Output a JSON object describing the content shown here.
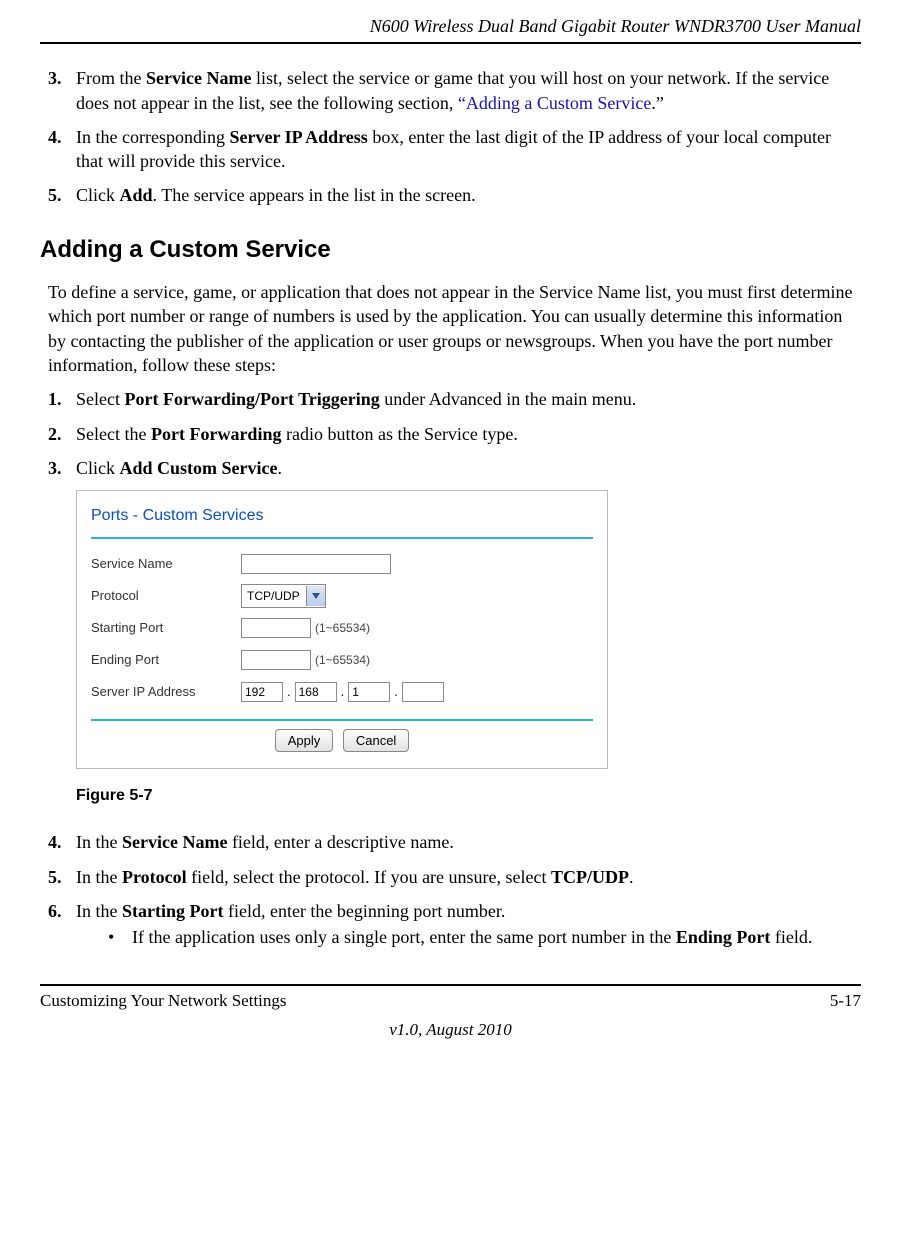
{
  "header": {
    "title": "N600 Wireless Dual Band Gigabit Router WNDR3700 User Manual"
  },
  "first_steps": [
    {
      "num": "3.",
      "text_before": "From the ",
      "bold1": "Service Name",
      "text_mid": " list, select the service or game that you will host on your network. If the service does not appear in the list, see the following section, ",
      "link_open": "“Adding a Custom Service",
      "link_after": ".”"
    },
    {
      "num": "4.",
      "text_before": "In the corresponding ",
      "bold1": "Server IP Address",
      "text_after": " box, enter the last digit of the IP address of your local computer that will provide this service."
    },
    {
      "num": "5.",
      "text_before": "Click ",
      "bold1": "Add",
      "text_after": ". The service appears in the list in the screen."
    }
  ],
  "section": {
    "title": "Adding a Custom Service",
    "intro": "To define a service, game, or application that does not appear in the Service Name list, you must first determine which port number or range of numbers is used by the application. You can usually determine this information by contacting the publisher of the application or user groups or newsgroups. When you have the port number information, follow these steps:"
  },
  "section_steps_a": [
    {
      "num": "1.",
      "pre": "Select ",
      "bold": "Port Forwarding/Port Triggering",
      "post": " under Advanced in the main menu."
    },
    {
      "num": "2.",
      "pre": "Select the ",
      "bold": "Port Forwarding",
      "post": " radio button as the Service type."
    },
    {
      "num": "3.",
      "pre": "Click ",
      "bold": "Add Custom Service",
      "post": "."
    }
  ],
  "figure": {
    "panel_title": "Ports - Custom Services",
    "rows": {
      "service_name": "Service Name",
      "protocol": "Protocol",
      "protocol_value": "TCP/UDP",
      "starting_port": "Starting Port",
      "ending_port": "Ending Port",
      "range_hint": "(1~65534)",
      "server_ip": "Server IP Address",
      "ip_a": "192",
      "ip_b": "168",
      "ip_c": "1",
      "ip_d": ""
    },
    "buttons": {
      "apply": "Apply",
      "cancel": "Cancel"
    },
    "caption": "Figure 5-7"
  },
  "section_steps_b": [
    {
      "num": "4.",
      "pre": "In the ",
      "bold": "Service Name",
      "post": " field, enter a descriptive name."
    },
    {
      "num": "5.",
      "pre": "In the ",
      "bold": "Protocol",
      "post": " field, select the protocol. If you are unsure, select ",
      "bold2": "TCP/UDP",
      "post2": "."
    },
    {
      "num": "6.",
      "pre": "In the ",
      "bold": "Starting Port",
      "post": " field, enter the beginning port number."
    }
  ],
  "bullets": [
    {
      "pre": "If the application uses only a single port, enter the same port number in the ",
      "bold": "Ending Port",
      "post": " field."
    }
  ],
  "footer": {
    "left": "Customizing Your Network Settings",
    "right": "5-17",
    "version": "v1.0, August 2010"
  }
}
